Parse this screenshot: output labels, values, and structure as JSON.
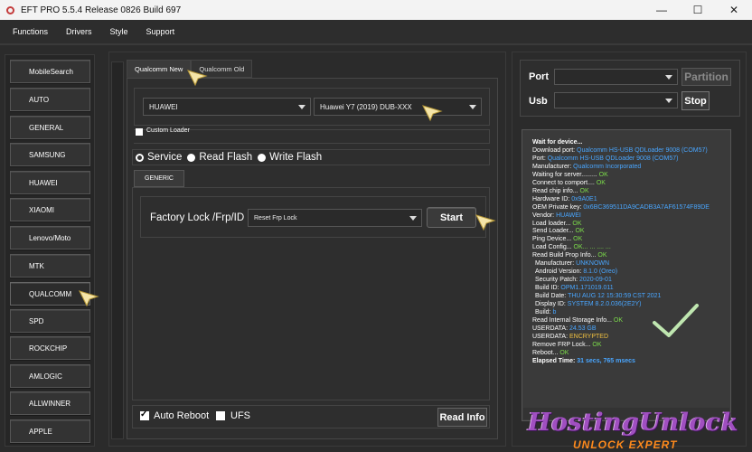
{
  "window": {
    "title": "EFT PRO 5.5.4 Release 0826 Build 697"
  },
  "window_controls": {
    "minimize": "—",
    "maximize": "☐",
    "close": "✕"
  },
  "menu": [
    "Functions",
    "Drivers",
    "Style",
    "Support"
  ],
  "sidebar": {
    "items": [
      {
        "label": "MobileSearch"
      },
      {
        "label": "AUTO"
      },
      {
        "label": "GENERAL"
      },
      {
        "label": "SAMSUNG"
      },
      {
        "label": "HUAWEI"
      },
      {
        "label": "XIAOMI"
      },
      {
        "label": "Lenovo/Moto"
      },
      {
        "label": "MTK"
      },
      {
        "label": "QUALCOMM",
        "active": true
      },
      {
        "label": "SPD"
      },
      {
        "label": "ROCKCHIP"
      },
      {
        "label": "AMLOGIC"
      },
      {
        "label": "ALLWINNER"
      },
      {
        "label": "APPLE"
      }
    ]
  },
  "tabs": [
    {
      "label": "Qualcomm New",
      "active": true
    },
    {
      "label": "Qualcomm Old",
      "active": false
    }
  ],
  "brand_select": {
    "value": "HUAWEI"
  },
  "model_select": {
    "value": "Huawei Y7 (2019) DUB-XXX"
  },
  "custom_loader": {
    "label": "Custom Loader",
    "checked": false
  },
  "modes": [
    {
      "label": "Service",
      "checked": true
    },
    {
      "label": "Read Flash",
      "checked": false
    },
    {
      "label": "Write Flash",
      "checked": false
    }
  ],
  "generic_tab": {
    "label": "GENERIC"
  },
  "frp": {
    "label": "Factory Lock /Frp/ID",
    "select_value": "Reset Frp Lock",
    "start_label": "Start"
  },
  "options": {
    "auto_reboot": {
      "label": "Auto Reboot",
      "checked": true
    },
    "ufs": {
      "label": "UFS",
      "checked": false
    }
  },
  "read_info_label": "Read Info",
  "port_panel": {
    "port_label": "Port",
    "usb_label": "Usb",
    "partition_label": "Partition",
    "stop_label": "Stop"
  },
  "log": [
    {
      "text": "Wait for device...",
      "title": true
    },
    {
      "text": "Download port: ",
      "value": "Qualcomm HS-USB QDLoader 9008 (COM57)",
      "color": "blue"
    },
    {
      "text": "Port: ",
      "value": "Qualcomm HS-USB QDLoader 9008 (COM57)",
      "color": "blue"
    },
    {
      "text": "Manufacturer: ",
      "value": "Qualcomm Incorporated",
      "color": "blue"
    },
    {
      "text": "Waiting for server......... ",
      "value": "OK",
      "color": "green"
    },
    {
      "text": "Connect to comport.... ",
      "value": "OK",
      "color": "green"
    },
    {
      "text": "Read chip info... ",
      "value": "OK",
      "color": "green"
    },
    {
      "text": "Hardware ID: ",
      "value": "0x9A0E1",
      "color": "blue"
    },
    {
      "text": "OEM Private key: ",
      "value": "0x6BC369511DA9CADB3A7AF61574F89DE",
      "color": "blue"
    },
    {
      "text": "Vendor: ",
      "value": "HUAWEI",
      "color": "blue"
    },
    {
      "text": "Load loader... ",
      "value": "OK",
      "color": "green"
    },
    {
      "text": "Send Loader... ",
      "value": "OK",
      "color": "green"
    },
    {
      "text": "Ping Device... ",
      "value": "OK",
      "color": "green"
    },
    {
      "text": "Load Config... ",
      "value": "OK... ... .... ...",
      "color": "green"
    },
    {
      "text": "Read Build Prop Info... ",
      "value": "OK",
      "color": "green"
    },
    {
      "text": " Manufacturer: ",
      "value": "UNKNOWN",
      "color": "blue",
      "indent": true
    },
    {
      "text": " Android Version: ",
      "value": "8.1.0 (Oreo)",
      "color": "blue",
      "indent": true
    },
    {
      "text": " Security Patch: ",
      "value": "2020-09-01",
      "color": "blue",
      "indent": true
    },
    {
      "text": " Build ID: ",
      "value": "OPM1.171019.011",
      "color": "blue",
      "indent": true
    },
    {
      "text": " Build Date: ",
      "value": "THU AUG 12 15:30:59 CST 2021",
      "color": "blue",
      "indent": true
    },
    {
      "text": " Display ID: ",
      "value": "SYSTEM 8.2.0.036(2E2Y)",
      "color": "blue",
      "indent": true
    },
    {
      "text": " Build: ",
      "value": "b",
      "color": "blue",
      "indent": true
    },
    {
      "text": "Read Internal Storage Info... ",
      "value": "OK",
      "color": "green"
    },
    {
      "text": "USERDATA: ",
      "value": "24.53 GB",
      "color": "blue"
    },
    {
      "text": "USERDATA: ",
      "value": "ENCRYPTED",
      "color": "yellow"
    },
    {
      "text": "Remove FRP Lock... ",
      "value": "OK",
      "color": "green"
    },
    {
      "text": "Reboot... ",
      "value": "OK",
      "color": "green"
    },
    {
      "text": "Elapsed Time: ",
      "value": "31 secs, 765 msecs",
      "color": "blue",
      "title": true
    }
  ],
  "watermark": {
    "main": "HostingUnlock",
    "sub": "UNLOCK EXPERT"
  },
  "colors": {
    "accent_blue": "#49a6ff",
    "ok_green": "#7cdc4a",
    "warn_yellow": "#f0c040",
    "pointer_yellow": "#f5e5a8",
    "watermark_purple": "#a04fc0",
    "watermark_orange": "#ff8a1c"
  }
}
